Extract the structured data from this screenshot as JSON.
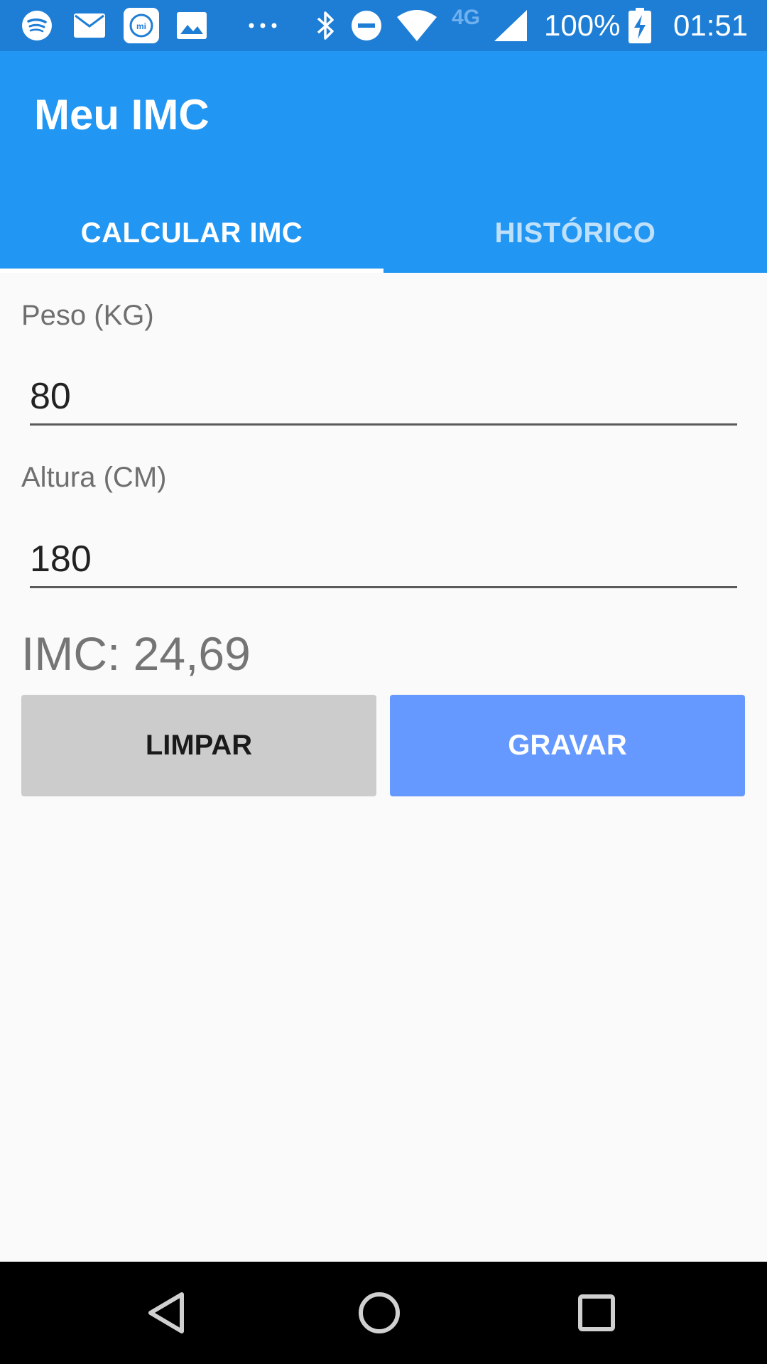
{
  "status_bar": {
    "battery": "100%",
    "time": "01:51",
    "network": "4G",
    "icons": [
      "spotify-icon",
      "mail-icon",
      "mi-fit-icon",
      "gallery-icon",
      "more-dots-icon",
      "bluetooth-icon",
      "do-not-disturb-icon",
      "wifi-icon",
      "cell-signal-icon",
      "battery-charging-icon"
    ]
  },
  "app_bar": {
    "title": "Meu IMC",
    "tabs": [
      {
        "label": "CALCULAR IMC",
        "active": true
      },
      {
        "label": "HISTÓRICO",
        "active": false
      }
    ]
  },
  "form": {
    "weight_label": "Peso (KG)",
    "weight_value": "80",
    "height_label": "Altura (CM)",
    "height_value": "180",
    "result": "IMC: 24,69"
  },
  "buttons": {
    "clear_label": "LIMPAR",
    "save_label": "GRAVAR"
  },
  "nav_bar": {
    "icons": [
      "back-icon",
      "home-icon",
      "recents-icon"
    ]
  },
  "colors": {
    "status_bar": "#1e7ed6",
    "primary": "#2196f3",
    "clear_button": "#cccccc",
    "save_button": "#6699ff",
    "background": "#fafafa"
  }
}
